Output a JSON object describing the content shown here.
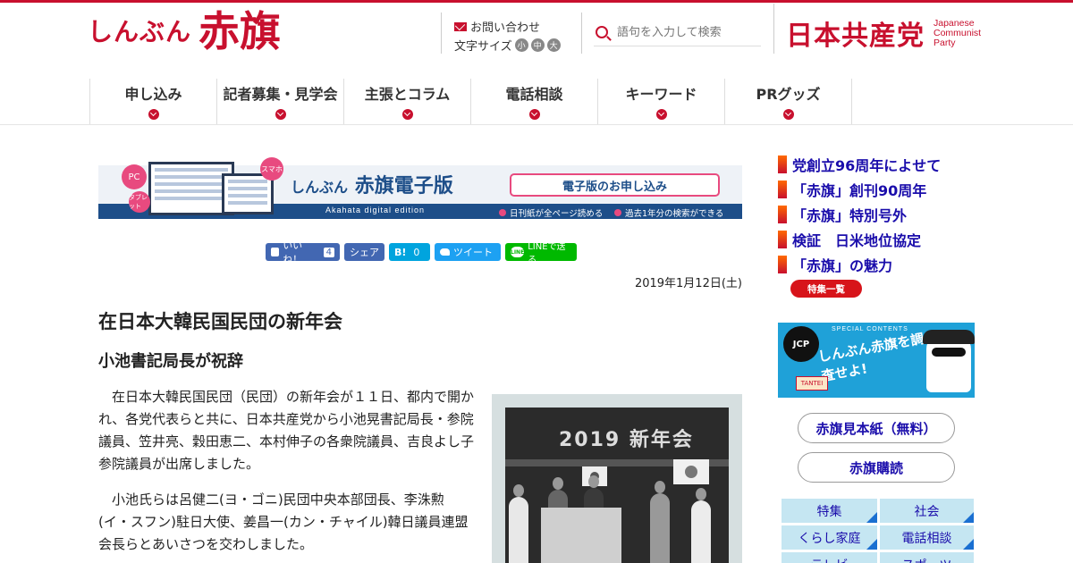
{
  "header": {
    "logo_small": "しんぶん",
    "logo_big": "赤旗",
    "contact_label": "お問い合わせ",
    "fontsize_label": "文字サイズ",
    "fontsize_options": [
      "小",
      "中",
      "大"
    ],
    "search_placeholder": "語句を入力して検索",
    "party_name_jp": "日本共産党",
    "party_name_en": [
      "Japanese",
      "Communist",
      "Party"
    ]
  },
  "nav": {
    "items": [
      {
        "label": "申し込み"
      },
      {
        "label": "記者募集・見学会"
      },
      {
        "label": "主張とコラム"
      },
      {
        "label": "電話相談"
      },
      {
        "label": "キーワード"
      },
      {
        "label": "PRグッズ"
      }
    ]
  },
  "banner": {
    "badge_pc": "PC",
    "badge_tablet": "タブレット",
    "badge_smaho": "スマホ",
    "title_small": "しんぶん",
    "title_main": "赤旗電子版",
    "subtitle": "Akahata digital edition",
    "apply_label": "電子版のお申し込み",
    "feature1": "日刊紙が全ページ読める",
    "feature2": "過去1年分の検索ができる"
  },
  "share": {
    "like_label": "いいね！",
    "like_count": "4",
    "share_label": "シェア",
    "hatena_label": "B!",
    "hatena_count": "0",
    "tweet_label": "ツイート",
    "line_icon": "LINE",
    "line_label": "LINEで送る"
  },
  "article": {
    "date": "2019年1月12日(土)",
    "headline": "在日本大韓民国民団の新年会",
    "subhead": "小池書記局長が祝辞",
    "paragraphs": [
      "在日本大韓民国民団（民団）の新年会が１１日、都内で開かれ、各党代表らと共に、日本共産党から小池晃書記局長・参院議員、笠井亮、穀田恵二、本村伸子の各衆院議員、吉良よし子参院議員が出席しました。",
      "小池氏らは呂健二(ヨ・ゴニ)民団中央本部団長、李洙勲(イ・スフン)駐日大使、姜昌一(カン・チャイル)韓日議員連盟会長らとあいさつを交わしました。"
    ],
    "photo_sign": "2019 新年会"
  },
  "sidebar": {
    "links": [
      {
        "label": "党創立96周年によせて"
      },
      {
        "label": "「赤旗」創刊90周年"
      },
      {
        "label": "「赤旗」特別号外"
      },
      {
        "label": "検証　日米地位協定"
      },
      {
        "label": "「赤旗」の魅力"
      }
    ],
    "tokushu_button": "特集一覧",
    "promo": {
      "badge": "JCP",
      "top_text": "SPECIAL CONTENTS",
      "text": "しんぶん赤旗を調査せよ!",
      "tag": "TANTEI"
    },
    "sample_label": "赤旗見本紙（無料）",
    "subscribe_label": "赤旗購読",
    "categories": [
      "特集",
      "社会",
      "くらし家庭",
      "電話相談",
      "テレビ",
      "スポーツ"
    ]
  },
  "colors": {
    "brand_red": "#c8102e",
    "link_blue": "#1a0dab",
    "digital_blue": "#1d4e89",
    "accent_pink": "#e84a7f"
  }
}
